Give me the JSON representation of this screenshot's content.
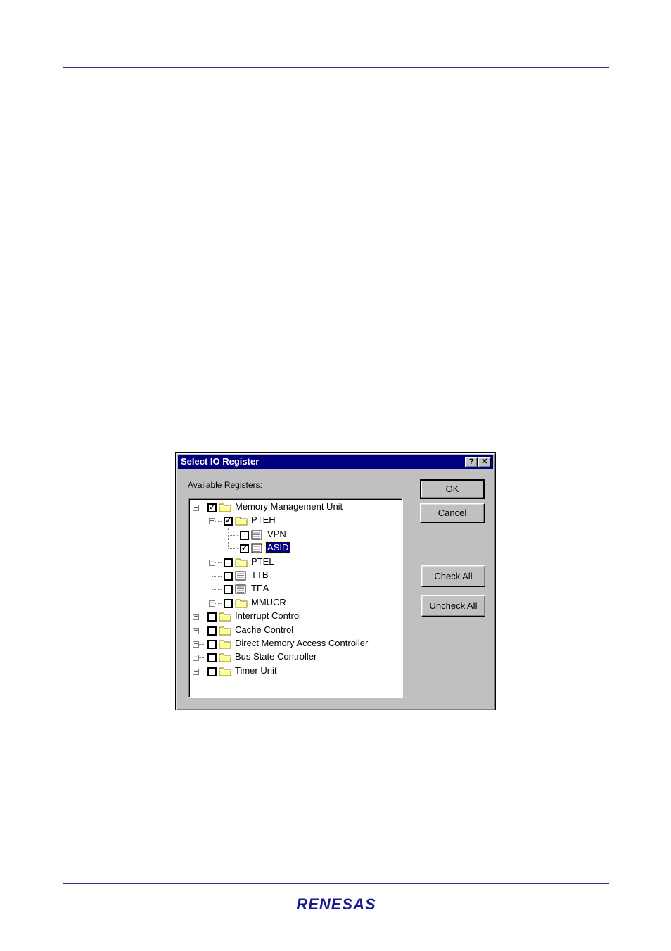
{
  "dialog": {
    "title": "Select IO Register",
    "help_glyph": "?",
    "close_glyph": "✕",
    "registers_label": "Available Registers:",
    "buttons": {
      "ok": "OK",
      "cancel": "Cancel",
      "check_all": "Check All",
      "uncheck_all": "Uncheck All"
    }
  },
  "tree": {
    "nodes": [
      {
        "label": "Memory Management Unit",
        "level": 0,
        "type": "folder",
        "expander": "−",
        "checked": true
      },
      {
        "label": "PTEH",
        "level": 1,
        "type": "folder",
        "expander": "−",
        "checked": true
      },
      {
        "label": "VPN",
        "level": 2,
        "type": "register",
        "expander": "",
        "checked": false
      },
      {
        "label": "ASID",
        "level": 2,
        "type": "register",
        "expander": "",
        "checked": true,
        "selected": true
      },
      {
        "label": "PTEL",
        "level": 1,
        "type": "folder",
        "expander": "+",
        "checked": false
      },
      {
        "label": "TTB",
        "level": 1,
        "type": "register",
        "expander": "",
        "checked": false
      },
      {
        "label": "TEA",
        "level": 1,
        "type": "register",
        "expander": "",
        "checked": false
      },
      {
        "label": "MMUCR",
        "level": 1,
        "type": "folder",
        "expander": "+",
        "checked": false
      },
      {
        "label": "Interrupt Control",
        "level": 0,
        "type": "folder",
        "expander": "+",
        "checked": false
      },
      {
        "label": "Cache Control",
        "level": 0,
        "type": "folder",
        "expander": "+",
        "checked": false
      },
      {
        "label": "Direct Memory Access Controller",
        "level": 0,
        "type": "folder",
        "expander": "+",
        "checked": false
      },
      {
        "label": "Bus State Controller",
        "level": 0,
        "type": "folder",
        "expander": "+",
        "checked": false
      },
      {
        "label": "Timer Unit",
        "level": 0,
        "type": "folder",
        "expander": "+",
        "checked": false
      }
    ],
    "check_glyph": "✓"
  },
  "logo": {
    "text": "RENESAS"
  },
  "colors": {
    "rule": "#2d2d8f",
    "titlebar": "#000080",
    "dialog_face": "#c0c0c0",
    "folder": "#ffff99",
    "logo": "#1a1a8c"
  }
}
